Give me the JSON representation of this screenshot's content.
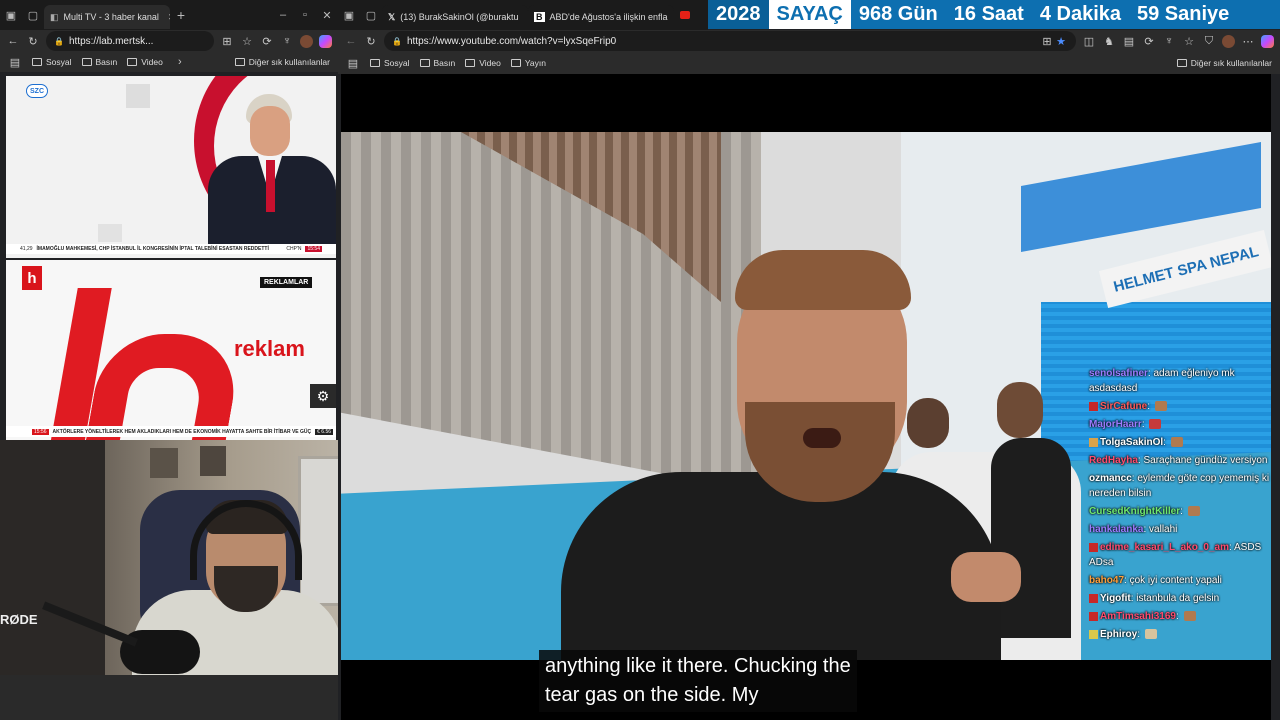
{
  "left_browser": {
    "tab_title": "Multi TV - 3 haber kanal",
    "url": "https://lab.mertsk...",
    "bookmarks": [
      "Sosyal",
      "Basın",
      "Video"
    ],
    "bookmarks_more": "Diğer sık kullanılanlar",
    "tv1": {
      "logo": "SZC",
      "ticker_time": "41,29",
      "ticker": "İMAMOĞLU MAHKEMESİ, CHP İSTANBUL İL KONGRESİNİN İPTAL TALEBİNİ ESASTAN REDDETTİ",
      "ticker_channel": "CHP'N",
      "clock": "15:54"
    },
    "tv2": {
      "badge": "REKLAMLAR",
      "text": "reklam",
      "ticker_time": "15:56",
      "ticker": "AKTÖRLERE YÖNELTİLEREK HEM AKLADIKLARI HEM DE EKONOMİK HAYATTA SAHTE BİR İTİBAR VE GÜÇ",
      "ticker_right": "€ 6.56"
    },
    "cam_brand": "RØDE"
  },
  "right_browser": {
    "tabs": [
      {
        "title": "(13) BurakSakinOl (@buraktu"
      },
      {
        "title": "ABD'de Ağustos'a ilişkin enfla"
      }
    ],
    "url": "https://www.youtube.com/watch?v=lyxSqeFrip0",
    "bookmarks": [
      "Sosyal",
      "Basın",
      "Video",
      "Yayın"
    ],
    "bookmarks_more": "Diğer sık kullanılanlar"
  },
  "counter": {
    "year": "2028",
    "label": "SAYAÇ",
    "days": "968 Gün",
    "hours": "16 Saat",
    "minutes": "4 Dakika",
    "seconds": "59 Saniye"
  },
  "video": {
    "sign": "HELMET SPA NEPAL",
    "subtitle_line1": "anything like it there. Chucking the",
    "subtitle_line2": "tear gas on the side. My"
  },
  "chat": [
    {
      "user": "senolsafiner",
      "msg": "adam eğleniyo mk asdasdasd",
      "color": "#9b7bff"
    },
    {
      "user": "SirCafune",
      "msg": "",
      "color": "#ff5a5a"
    },
    {
      "user": "MajorHaarr",
      "msg": "",
      "color": "#9b7bff"
    },
    {
      "user": "TolgaSakinOl",
      "msg": "",
      "color": "#ffffff"
    },
    {
      "user": "RedHayha",
      "msg": "Saraçhane gündüz versiyon",
      "color": "#ff4b6e"
    },
    {
      "user": "ozmancc",
      "msg": "eylemde göte cop yememiş ki nereden bilsin",
      "color": "#ffffff"
    },
    {
      "user": "CursedKnightKiller",
      "msg": "",
      "color": "#6fe86f"
    },
    {
      "user": "hankalanka",
      "msg": "vallahi",
      "color": "#9b7bff"
    },
    {
      "user": "edime_kasari_L_ako_0_am",
      "msg": "ASDS ADsa",
      "color": "#ff4b6e"
    },
    {
      "user": "baho47",
      "msg": "çok iyi content yapali",
      "color": "#ff9f3b"
    },
    {
      "user": "Yigofit",
      "msg": "istanbula da gelsin",
      "color": "#ffffff"
    },
    {
      "user": "AmTimsahi3169",
      "msg": "",
      "color": "#ff4b6e"
    },
    {
      "user": "Ephiroy",
      "msg": "",
      "color": "#ffffff"
    }
  ]
}
